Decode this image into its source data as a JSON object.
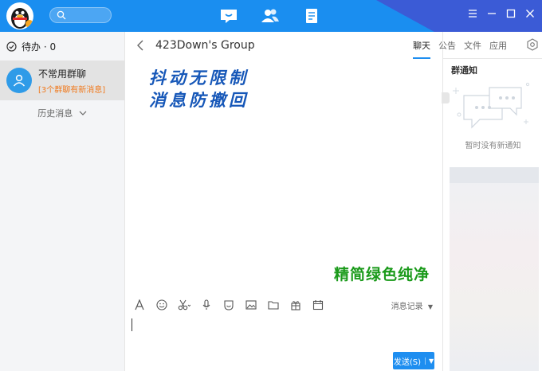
{
  "titlebar": {
    "search_placeholder": "",
    "nav_icons": [
      "chat-icon",
      "contacts-icon",
      "files-icon"
    ]
  },
  "left": {
    "todo_label": "待办 · 0",
    "conversation": {
      "name": "不常用群聊",
      "subtitle": "[3个群聊有新消息]"
    },
    "history_label": "历史消息"
  },
  "chat": {
    "group_name": "423Down's Group",
    "overlay_line1": "抖动无限制",
    "overlay_line2": "消息防撤回",
    "overlay_green": "精简绿色纯净",
    "message_history": "消息记录",
    "send_label": "发送(S)"
  },
  "right": {
    "tabs": [
      "聊天",
      "公告",
      "文件",
      "应用"
    ],
    "notice_title": "群通知",
    "notice_empty": "暂时没有新通知"
  },
  "colors": {
    "accent": "#1e8ef0",
    "title_bar": "#1a8ef0",
    "overlay_blue": "#1657b8",
    "overlay_green": "#1a9a1a",
    "badge_orange": "#f07a1e"
  }
}
